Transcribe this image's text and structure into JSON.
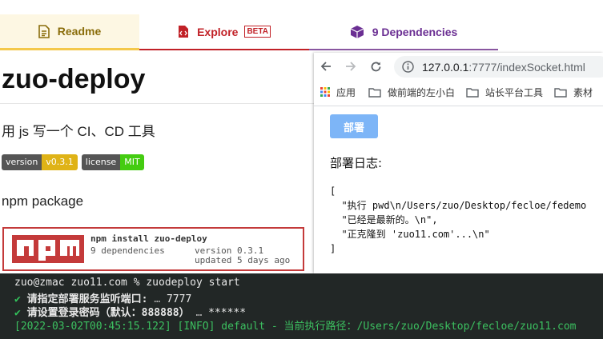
{
  "tabs": [
    {
      "label": "Readme"
    },
    {
      "label": "Explore",
      "badge": "BETA"
    },
    {
      "label": "9 Dependencies"
    }
  ],
  "readme": {
    "title": "zuo-deploy",
    "description": "用 js 写一个 CI、CD 工具",
    "badges": [
      {
        "left": "version",
        "right": "v0.3.1",
        "color": "#dfb317"
      },
      {
        "left": "license",
        "right": "MIT",
        "color": "#4c1"
      }
    ],
    "subtitle": "npm package",
    "npm_card": {
      "command": "npm install zuo-deploy",
      "dependencies": "9 dependencies",
      "version": "version 0.3.1",
      "updated": "updated 5 days ago"
    }
  },
  "browser": {
    "url_host": "127.0.0.1",
    "url_rest": ":7777/indexSocket.html",
    "bookmarks": [
      "应用",
      "做前端的左小白",
      "站长平台工具",
      "素材"
    ],
    "deploy_button": "部署",
    "log_title": "部署日志:",
    "log_lines": [
      "[",
      "  \"执行 pwd\\n/Users/zuo/Desktop/fecloe/fedemo",
      "  \"已经是最新的。\\n\",",
      "  \"正克隆到 'zuo11.com'...\\n\"",
      "]"
    ]
  },
  "terminal": {
    "prompt_line": "zuo@zmac zuo11.com % zuodeploy start",
    "q1_mark": "✔",
    "q1_label": "请指定部署服务监听端口:",
    "q1_ellipsis": "…",
    "q1_value": "7777",
    "q2_mark": "✔",
    "q2_label": "请设置登录密码（默认：888888）",
    "q2_ellipsis": "…",
    "q2_value": "******",
    "log_line": "[2022-03-02T00:45:15.122] [INFO] default - 当前执行路径：/Users/zuo/Desktop/fecloe/zuo11.com"
  },
  "colors": {
    "npm_red": "#c12127",
    "deps_purple": "#6b2f93",
    "readme_gold": "#8a6d0b",
    "deploy_button": "#7db5f7",
    "terminal_bg": "#222726",
    "terminal_green": "#33c25b"
  },
  "icons": {
    "readme": "document-icon",
    "explore": "file-code-icon",
    "dependencies": "box-icon"
  }
}
